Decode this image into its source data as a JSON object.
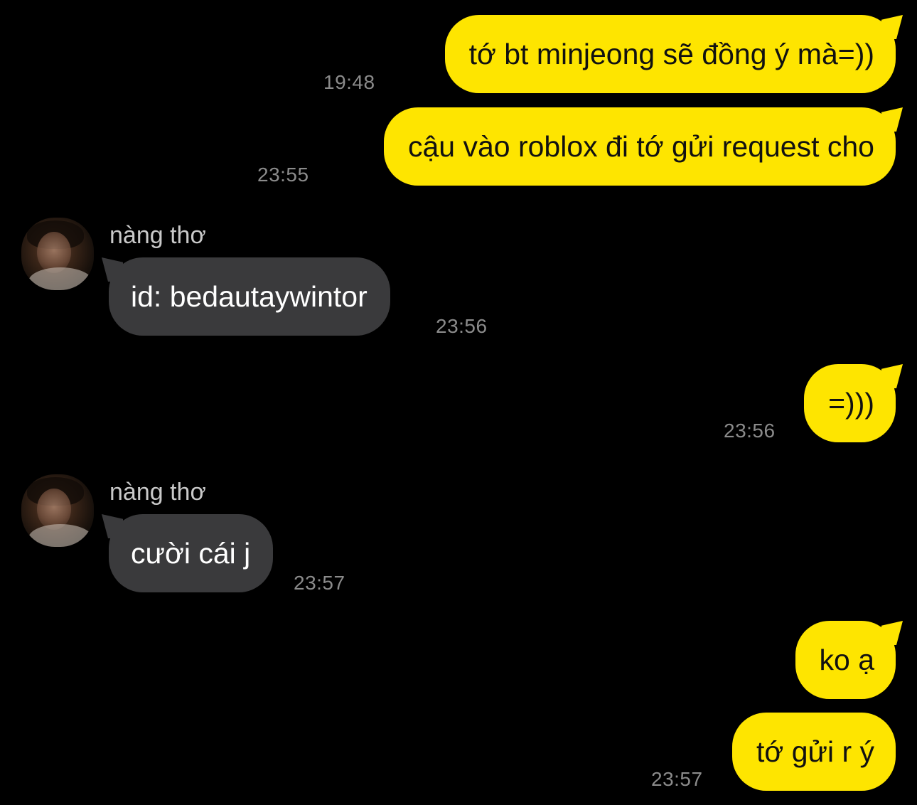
{
  "conversation": {
    "contact_name": "nàng thơ",
    "colors": {
      "outgoing_bubble": "#FEE500",
      "incoming_bubble": "#3a3a3c",
      "background": "#000000",
      "timestamp": "#8b8b8b"
    },
    "messages": [
      {
        "direction": "out",
        "text": "tớ bt minjeong sẽ đồng ý mà=))",
        "time": "19:48"
      },
      {
        "direction": "out",
        "text": "cậu vào roblox đi tớ gửi request cho",
        "time": "23:55"
      },
      {
        "direction": "in",
        "sender": "nàng thơ",
        "text": "id: bedautaywintor",
        "time": "23:56"
      },
      {
        "direction": "out",
        "text": "=)))",
        "time": "23:56"
      },
      {
        "direction": "in",
        "sender": "nàng thơ",
        "text": "cười cái j",
        "time": "23:57"
      },
      {
        "direction": "out",
        "text": "ko ạ",
        "time": ""
      },
      {
        "direction": "out",
        "text": "tớ gửi r ý",
        "time": "23:57"
      }
    ]
  }
}
